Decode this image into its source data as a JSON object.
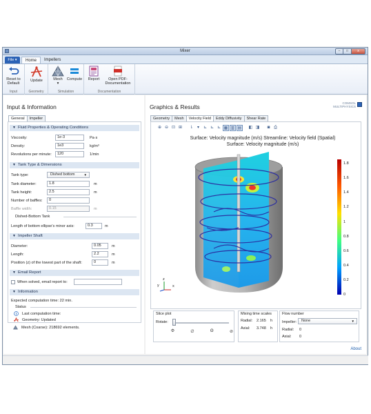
{
  "window": {
    "title": "Mixer",
    "controls": {
      "minimize": "–",
      "maximize": "□",
      "close": "x"
    }
  },
  "ribbon": {
    "file_label": "File ▾",
    "tabs": [
      "Home",
      "Impellers"
    ],
    "buttons": {
      "reset": [
        "Reset to",
        "Default"
      ],
      "update": "Update",
      "mesh": "Mesh",
      "compute": "Compute",
      "report": "Report",
      "open_pdf": [
        "Open PDF-",
        "Documentation"
      ]
    },
    "groups": [
      "Input",
      "Geometry",
      "Simulation",
      "Documentation"
    ]
  },
  "input_panel": {
    "title": "Input & Information",
    "tabs": [
      "General",
      "Impeller"
    ],
    "sections": {
      "fluid": "Fluid Properties & Operating Conditions",
      "tank": "Tank Type & Dimensions",
      "shaft": "Impeller Shaft",
      "email": "Email Report",
      "info": "Information"
    },
    "fluid": {
      "viscosity": {
        "label": "Viscosity:",
        "value": "1e-3",
        "unit": "Pa·s"
      },
      "density": {
        "label": "Density:",
        "value": "1e3",
        "unit": "kg/m³"
      },
      "rpm": {
        "label": "Revolutions per minute:",
        "value": "120",
        "unit": "1/min"
      }
    },
    "tank": {
      "type": {
        "label": "Tank type:",
        "value": "Dished bottom"
      },
      "diameter": {
        "label": "Tank diameter:",
        "value": "1.8",
        "unit": "m"
      },
      "height": {
        "label": "Tank height:",
        "value": "2.5",
        "unit": "m"
      },
      "baffles": {
        "label": "Number of baffles:",
        "value": "0"
      },
      "baffle_width": {
        "label": "Baffle width:",
        "value": "0.15",
        "unit": "m"
      },
      "subsection": "Dished-Bottom Tank",
      "minor_axis": {
        "label": "Length of bottom ellipse's minor axis:",
        "value": "0.3",
        "unit": "m"
      }
    },
    "shaft": {
      "diameter": {
        "label": "Diameter:",
        "value": "0.05",
        "unit": "m"
      },
      "length": {
        "label": "Length:",
        "value": "2.2",
        "unit": "m"
      },
      "position": {
        "label": "Position (z) of the lowest part of the shaft:",
        "value": "0",
        "unit": "m"
      }
    },
    "email": {
      "label": "When solved, email report to:",
      "value": ""
    },
    "info": {
      "expected": "Expected computation time:  22 min.",
      "status_label": "Status",
      "items": [
        "Last computation time:",
        "Geometry: Updated",
        "Mesh (Coarse): 218692 elements."
      ]
    }
  },
  "graphics_panel": {
    "title": "Graphics & Results",
    "logo": [
      "COMSOL",
      "MULTIPHYSICS"
    ],
    "tabs": [
      "Geometry",
      "Mesh",
      "Velocity Field",
      "Eddy Diffusivity",
      "Shear Rate"
    ],
    "plot_title": [
      "Surface: Velocity magnitude (m/s)  Streamline: Velocity field (Spatial)",
      "Surface: Velocity magnitude (m/s)"
    ],
    "colorbar_ticks": [
      "1.8",
      "1.6",
      "1.4",
      "1.2",
      "1",
      "0.8",
      "0.6",
      "0.4",
      "0.2",
      "0"
    ],
    "axes": {
      "y": "y",
      "z": "z",
      "x": "x"
    },
    "slice_plot": {
      "title": "Slice plot",
      "rotate_label": "Rotate:"
    },
    "mixing": {
      "title": "Mixing time scales",
      "radial": {
        "label": "Radial:",
        "value": "2.165",
        "unit": "h"
      },
      "axial": {
        "label": "Axial:",
        "value": "3.748",
        "unit": "h"
      }
    },
    "flow": {
      "title": "Flow number",
      "impeller": {
        "label": "Impeller:",
        "value": "None"
      },
      "radial": {
        "label": "Radial:",
        "value": "0"
      },
      "axial": {
        "label": "Axial:",
        "value": "0"
      }
    }
  },
  "footer": {
    "about": "About"
  },
  "colors": {
    "accent": "#2b62b6",
    "section_bg": "#dce6f2",
    "link": "#1f5fae"
  }
}
